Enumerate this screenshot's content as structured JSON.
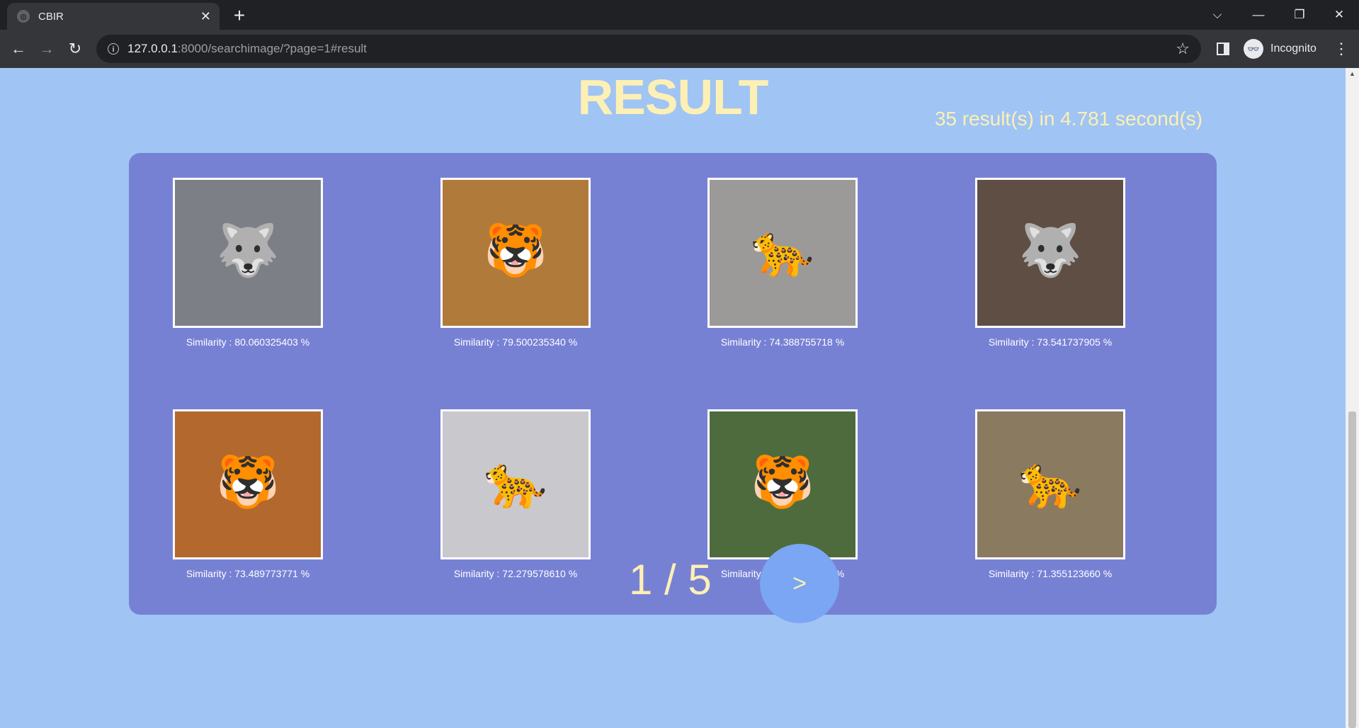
{
  "browser": {
    "tab_title": "CBIR",
    "tab_close": "✕",
    "new_tab": "+",
    "url_host": "127.0.0.1",
    "url_rest": ":8000/searchimage/?page=1#result",
    "incognito_label": "Incognito",
    "window_controls": {
      "dropdown": "⌵",
      "minimize": "—",
      "restore": "❐",
      "close": "✕"
    }
  },
  "page": {
    "title": "RESULT",
    "stats": "35 result(s) in 4.781 second(s)",
    "results": [
      {
        "similarity": "Similarity : 80.060325403 %",
        "icon": "wolf-icon",
        "glyph": "🐺",
        "color": "#7d7f86"
      },
      {
        "similarity": "Similarity : 79.500235340 %",
        "icon": "tiger-icon",
        "glyph": "🐯",
        "color": "#b07a3a"
      },
      {
        "similarity": "Similarity : 74.388755718 %",
        "icon": "snow-leopard-icon",
        "glyph": "🐆",
        "color": "#9c9a98"
      },
      {
        "similarity": "Similarity : 73.541737905 %",
        "icon": "wolf-icon",
        "glyph": "🐺",
        "color": "#5f4e44"
      },
      {
        "similarity": "Similarity : 73.489773771 %",
        "icon": "tiger-icon",
        "glyph": "🐯",
        "color": "#b3682e"
      },
      {
        "similarity": "Similarity : 72.279578610 %",
        "icon": "snow-leopard-icon",
        "glyph": "🐆",
        "color": "#c9c9cd"
      },
      {
        "similarity": "Similarity : 71.673194281 %",
        "icon": "tiger-icon",
        "glyph": "🐯",
        "color": "#4e6b3d"
      },
      {
        "similarity": "Similarity : 71.355123660 %",
        "icon": "leopard-icon",
        "glyph": "🐆",
        "color": "#8a7a60"
      }
    ],
    "pager": {
      "text": "1 / 5",
      "next_label": ">"
    }
  }
}
